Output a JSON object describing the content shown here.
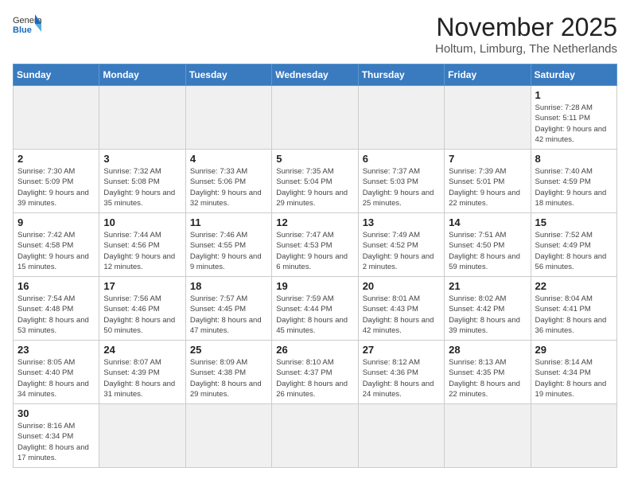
{
  "header": {
    "logo_general": "General",
    "logo_blue": "Blue",
    "title": "November 2025",
    "subtitle": "Holtum, Limburg, The Netherlands"
  },
  "calendar": {
    "days_of_week": [
      "Sunday",
      "Monday",
      "Tuesday",
      "Wednesday",
      "Thursday",
      "Friday",
      "Saturday"
    ],
    "weeks": [
      [
        {
          "day": "",
          "info": "",
          "empty": true
        },
        {
          "day": "",
          "info": "",
          "empty": true
        },
        {
          "day": "",
          "info": "",
          "empty": true
        },
        {
          "day": "",
          "info": "",
          "empty": true
        },
        {
          "day": "",
          "info": "",
          "empty": true
        },
        {
          "day": "",
          "info": "",
          "empty": true
        },
        {
          "day": "1",
          "info": "Sunrise: 7:28 AM\nSunset: 5:11 PM\nDaylight: 9 hours\nand 42 minutes."
        }
      ],
      [
        {
          "day": "2",
          "info": "Sunrise: 7:30 AM\nSunset: 5:09 PM\nDaylight: 9 hours\nand 39 minutes."
        },
        {
          "day": "3",
          "info": "Sunrise: 7:32 AM\nSunset: 5:08 PM\nDaylight: 9 hours\nand 35 minutes."
        },
        {
          "day": "4",
          "info": "Sunrise: 7:33 AM\nSunset: 5:06 PM\nDaylight: 9 hours\nand 32 minutes."
        },
        {
          "day": "5",
          "info": "Sunrise: 7:35 AM\nSunset: 5:04 PM\nDaylight: 9 hours\nand 29 minutes."
        },
        {
          "day": "6",
          "info": "Sunrise: 7:37 AM\nSunset: 5:03 PM\nDaylight: 9 hours\nand 25 minutes."
        },
        {
          "day": "7",
          "info": "Sunrise: 7:39 AM\nSunset: 5:01 PM\nDaylight: 9 hours\nand 22 minutes."
        },
        {
          "day": "8",
          "info": "Sunrise: 7:40 AM\nSunset: 4:59 PM\nDaylight: 9 hours\nand 18 minutes."
        }
      ],
      [
        {
          "day": "9",
          "info": "Sunrise: 7:42 AM\nSunset: 4:58 PM\nDaylight: 9 hours\nand 15 minutes."
        },
        {
          "day": "10",
          "info": "Sunrise: 7:44 AM\nSunset: 4:56 PM\nDaylight: 9 hours\nand 12 minutes."
        },
        {
          "day": "11",
          "info": "Sunrise: 7:46 AM\nSunset: 4:55 PM\nDaylight: 9 hours\nand 9 minutes."
        },
        {
          "day": "12",
          "info": "Sunrise: 7:47 AM\nSunset: 4:53 PM\nDaylight: 9 hours\nand 6 minutes."
        },
        {
          "day": "13",
          "info": "Sunrise: 7:49 AM\nSunset: 4:52 PM\nDaylight: 9 hours\nand 2 minutes."
        },
        {
          "day": "14",
          "info": "Sunrise: 7:51 AM\nSunset: 4:50 PM\nDaylight: 8 hours\nand 59 minutes."
        },
        {
          "day": "15",
          "info": "Sunrise: 7:52 AM\nSunset: 4:49 PM\nDaylight: 8 hours\nand 56 minutes."
        }
      ],
      [
        {
          "day": "16",
          "info": "Sunrise: 7:54 AM\nSunset: 4:48 PM\nDaylight: 8 hours\nand 53 minutes."
        },
        {
          "day": "17",
          "info": "Sunrise: 7:56 AM\nSunset: 4:46 PM\nDaylight: 8 hours\nand 50 minutes."
        },
        {
          "day": "18",
          "info": "Sunrise: 7:57 AM\nSunset: 4:45 PM\nDaylight: 8 hours\nand 47 minutes."
        },
        {
          "day": "19",
          "info": "Sunrise: 7:59 AM\nSunset: 4:44 PM\nDaylight: 8 hours\nand 45 minutes."
        },
        {
          "day": "20",
          "info": "Sunrise: 8:01 AM\nSunset: 4:43 PM\nDaylight: 8 hours\nand 42 minutes."
        },
        {
          "day": "21",
          "info": "Sunrise: 8:02 AM\nSunset: 4:42 PM\nDaylight: 8 hours\nand 39 minutes."
        },
        {
          "day": "22",
          "info": "Sunrise: 8:04 AM\nSunset: 4:41 PM\nDaylight: 8 hours\nand 36 minutes."
        }
      ],
      [
        {
          "day": "23",
          "info": "Sunrise: 8:05 AM\nSunset: 4:40 PM\nDaylight: 8 hours\nand 34 minutes."
        },
        {
          "day": "24",
          "info": "Sunrise: 8:07 AM\nSunset: 4:39 PM\nDaylight: 8 hours\nand 31 minutes."
        },
        {
          "day": "25",
          "info": "Sunrise: 8:09 AM\nSunset: 4:38 PM\nDaylight: 8 hours\nand 29 minutes."
        },
        {
          "day": "26",
          "info": "Sunrise: 8:10 AM\nSunset: 4:37 PM\nDaylight: 8 hours\nand 26 minutes."
        },
        {
          "day": "27",
          "info": "Sunrise: 8:12 AM\nSunset: 4:36 PM\nDaylight: 8 hours\nand 24 minutes."
        },
        {
          "day": "28",
          "info": "Sunrise: 8:13 AM\nSunset: 4:35 PM\nDaylight: 8 hours\nand 22 minutes."
        },
        {
          "day": "29",
          "info": "Sunrise: 8:14 AM\nSunset: 4:34 PM\nDaylight: 8 hours\nand 19 minutes."
        }
      ],
      [
        {
          "day": "30",
          "info": "Sunrise: 8:16 AM\nSunset: 4:34 PM\nDaylight: 8 hours\nand 17 minutes."
        },
        {
          "day": "",
          "info": "",
          "empty": true
        },
        {
          "day": "",
          "info": "",
          "empty": true
        },
        {
          "day": "",
          "info": "",
          "empty": true
        },
        {
          "day": "",
          "info": "",
          "empty": true
        },
        {
          "day": "",
          "info": "",
          "empty": true
        },
        {
          "day": "",
          "info": "",
          "empty": true
        }
      ]
    ]
  }
}
